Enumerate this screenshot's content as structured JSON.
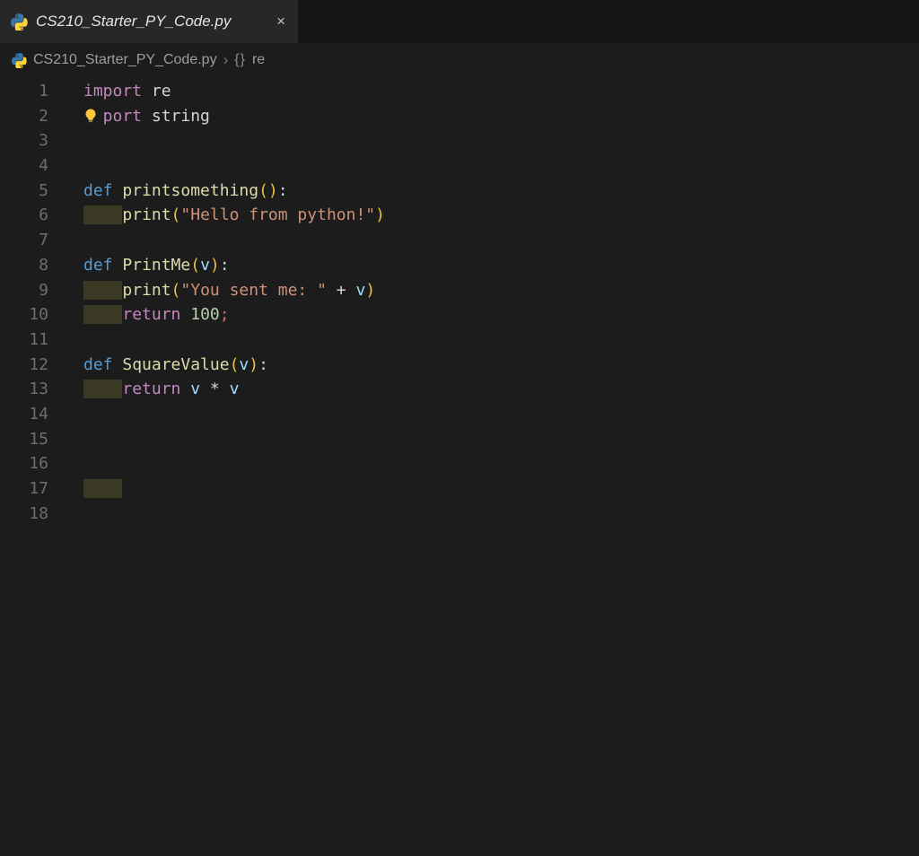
{
  "colors": {
    "editor-bg": "#1c1c1c",
    "tabbar-bg": "#141414",
    "tab-bg": "#272727",
    "tab-title-color": "#e4e4e4",
    "c-kw": "#C586C0",
    "c-def": "#569CD6",
    "c-fn": "#DCDCAA",
    "c-str": "#CE9178",
    "c-num": "#B5CEA8",
    "c-var": "#9CDCFE",
    "c-plain": "#D4D4D4",
    "c-bracket": "#E9C341",
    "c-err": "#D16969",
    "c-indent-hl": "#3a3a24",
    "c-linenum": "#6e6e6e",
    "c-breadcrumb": "#9d9d9d"
  },
  "tab": {
    "title": "CS210_Starter_PY_Code.py",
    "close_label": "×",
    "icon": "python-icon"
  },
  "breadcrumb": {
    "file": "CS210_Starter_PY_Code.py",
    "separator": "›",
    "symbol_kind_icon": "{}",
    "symbol": "re"
  },
  "editor": {
    "language": "python",
    "lines": [
      {
        "num": "1",
        "tokens": [
          {
            "t": "import",
            "c": "kw"
          },
          {
            "t": " re",
            "c": "plain"
          }
        ]
      },
      {
        "num": "2",
        "lightbulb": true,
        "tokens": [
          {
            "t": "import",
            "c": "kw"
          },
          {
            "t": " string",
            "c": "plain"
          }
        ]
      },
      {
        "num": "3",
        "tokens": []
      },
      {
        "num": "4",
        "tokens": []
      },
      {
        "num": "5",
        "tokens": [
          {
            "t": "def",
            "c": "def"
          },
          {
            "t": " ",
            "c": "plain"
          },
          {
            "t": "printsomething",
            "c": "fn"
          },
          {
            "t": "(",
            "c": "bracket"
          },
          {
            "t": ")",
            "c": "bracket"
          },
          {
            "t": ":",
            "c": "plain"
          }
        ]
      },
      {
        "num": "6",
        "indent_hl": true,
        "tokens": [
          {
            "t": "print",
            "c": "fn"
          },
          {
            "t": "(",
            "c": "bracket"
          },
          {
            "t": "\"Hello from python!\"",
            "c": "str"
          },
          {
            "t": ")",
            "c": "bracket"
          }
        ]
      },
      {
        "num": "7",
        "tokens": []
      },
      {
        "num": "8",
        "tokens": [
          {
            "t": "def",
            "c": "def"
          },
          {
            "t": " ",
            "c": "plain"
          },
          {
            "t": "PrintMe",
            "c": "fn"
          },
          {
            "t": "(",
            "c": "bracket"
          },
          {
            "t": "v",
            "c": "var"
          },
          {
            "t": ")",
            "c": "bracket"
          },
          {
            "t": ":",
            "c": "plain"
          }
        ]
      },
      {
        "num": "9",
        "indent_hl": true,
        "tokens": [
          {
            "t": "print",
            "c": "fn"
          },
          {
            "t": "(",
            "c": "bracket"
          },
          {
            "t": "\"You sent me: \"",
            "c": "str"
          },
          {
            "t": " + ",
            "c": "plain"
          },
          {
            "t": "v",
            "c": "var"
          },
          {
            "t": ")",
            "c": "bracket"
          }
        ]
      },
      {
        "num": "10",
        "indent_hl": true,
        "tokens": [
          {
            "t": "return",
            "c": "kw"
          },
          {
            "t": " ",
            "c": "plain"
          },
          {
            "t": "100",
            "c": "num"
          },
          {
            "t": ";",
            "c": "err"
          }
        ]
      },
      {
        "num": "11",
        "tokens": []
      },
      {
        "num": "12",
        "tokens": [
          {
            "t": "def",
            "c": "def"
          },
          {
            "t": " ",
            "c": "plain"
          },
          {
            "t": "SquareValue",
            "c": "fn"
          },
          {
            "t": "(",
            "c": "bracket"
          },
          {
            "t": "v",
            "c": "var"
          },
          {
            "t": ")",
            "c": "bracket"
          },
          {
            "t": ":",
            "c": "plain"
          }
        ]
      },
      {
        "num": "13",
        "indent_hl": true,
        "tokens": [
          {
            "t": "return",
            "c": "kw"
          },
          {
            "t": " ",
            "c": "plain"
          },
          {
            "t": "v",
            "c": "var"
          },
          {
            "t": " ",
            "c": "plain"
          },
          {
            "t": "*",
            "c": "plain"
          },
          {
            "t": " ",
            "c": "plain"
          },
          {
            "t": "v",
            "c": "var"
          }
        ]
      },
      {
        "num": "14",
        "tokens": []
      },
      {
        "num": "15",
        "tokens": []
      },
      {
        "num": "16",
        "tokens": []
      },
      {
        "num": "17",
        "indent_hl": true,
        "tokens": []
      },
      {
        "num": "18",
        "tokens": []
      }
    ]
  }
}
